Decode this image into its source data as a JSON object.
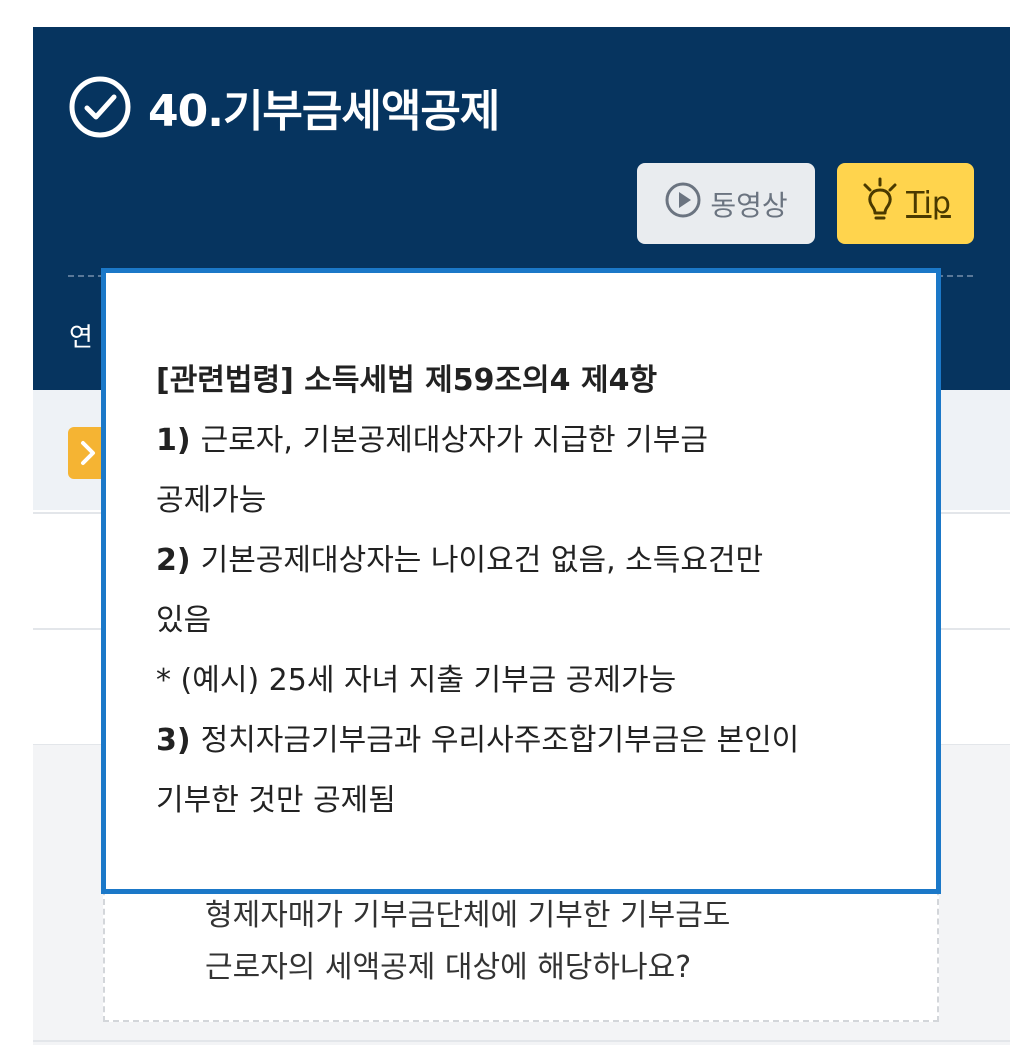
{
  "header": {
    "title": "40.기부금세액공제",
    "video_button_label": "동영상",
    "tip_button_label": "Tip",
    "partial_text": "연"
  },
  "qa": {
    "lines": [
      "형제자매가 기부금단체에 기부한 기부금도",
      "근로자의 세액공제 대상에 해당하나요?"
    ]
  },
  "popup": {
    "heading": "[관련법령] 소득세법 제59조의4 제4항",
    "items": [
      {
        "num": "1)",
        "line1": "근로자, 기본공제대상자가 지급한 기부금",
        "line2": "공제가능"
      },
      {
        "num": "2)",
        "line1": "기본공제대상자는 나이요건 없음, 소득요건만",
        "line2": "있음"
      },
      {
        "note": "* (예시) 25세 자녀 지출 기부금 공제가능"
      },
      {
        "num": "3)",
        "line1": "정치자금기부금과 우리사주조합기부금은 본인이",
        "line2": "기부한 것만 공제됨"
      }
    ]
  },
  "colors": {
    "header_bg": "#06345f",
    "tip_bg": "#ffd44d",
    "video_bg": "#e9ecef",
    "popup_border": "#1b78c8",
    "chip_bg": "#f5b433"
  },
  "icons": {
    "title": "check-circle-icon",
    "video": "play-circle-icon",
    "tip": "lightbulb-icon",
    "chip": "chevron-right-icon"
  }
}
